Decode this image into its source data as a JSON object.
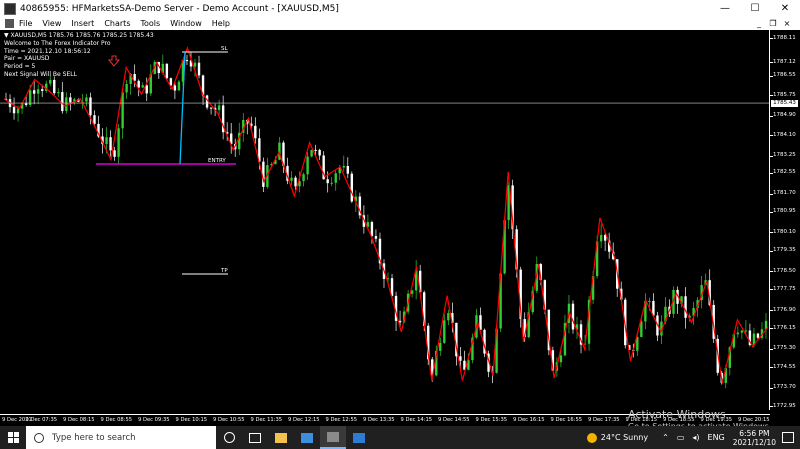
{
  "window": {
    "title": "40865955: HFMarketsSA-Demo Server - Demo Account - [XAUUSD,M5]",
    "minimize": "—",
    "maximize": "☐",
    "close": "✕"
  },
  "menu": {
    "items": [
      "File",
      "View",
      "Insert",
      "Charts",
      "Tools",
      "Window",
      "Help"
    ],
    "mdi": [
      "_",
      "❐",
      "×"
    ]
  },
  "chart": {
    "header": "XAUUSD,M5  1785.76 1785.76 1785.25 1785.43",
    "indicator_lines": [
      "Welcome to The Forex Indicator Pro",
      "Time = 2021.12.10 18:56:12",
      "Pair = XAUUSD",
      "Period = 5",
      "Next Signal Will Be SELL"
    ],
    "sl_label": "SL",
    "entry_label": "ENTRY",
    "tp_label": "TP",
    "current_price": "1785.43",
    "y_ticks": [
      "1788.11",
      "1787.12",
      "1786.55",
      "1785.75",
      "1784.90",
      "1784.10",
      "1783.25",
      "1782.55",
      "1781.70",
      "1780.95",
      "1780.10",
      "1779.35",
      "1778.50",
      "1777.75",
      "1776.90",
      "1776.15",
      "1775.30",
      "1774.55",
      "1773.70",
      "1772.95"
    ],
    "x_ticks": [
      "9 Dec 2021",
      "9 Dec 07:35",
      "9 Dec 08:15",
      "9 Dec 08:55",
      "9 Dec 09:35",
      "9 Dec 10:15",
      "9 Dec 10:55",
      "9 Dec 11:35",
      "9 Dec 12:15",
      "9 Dec 12:55",
      "9 Dec 13:35",
      "9 Dec 14:15",
      "9 Dec 14:55",
      "9 Dec 15:35",
      "9 Dec 16:15",
      "9 Dec 16:55",
      "9 Dec 17:35",
      "9 Dec 18:15",
      "9 Dec 18:55",
      "9 Dec 19:35",
      "9 Dec 20:15"
    ],
    "colors": {
      "bull": "#32cd32",
      "bear": "#ffffff",
      "zigzag": "#ff0000",
      "entry_line": "#ff00ff",
      "sl_tp": "#ffffff",
      "stem": "#00bfff"
    },
    "chart_data": {
      "type": "candlestick",
      "y_range": [
        1772.95,
        1788.11
      ],
      "zigzag_close": [
        1785.6,
        1785.2,
        1786.4,
        1785.9,
        1785.3,
        1785.6,
        1784.4,
        1783.1,
        1786.9,
        1785.8,
        1787.1,
        1786.0,
        1787.7,
        1785.8,
        1785.0,
        1783.5,
        1784.8,
        1782.2,
        1783.4,
        1781.6,
        1783.8,
        1782.4,
        1782.8,
        1781.4,
        1780.0,
        1778.3,
        1776.0,
        1778.7,
        1774.0,
        1777.5,
        1774.0,
        1776.4,
        1774.2,
        1782.6,
        1775.6,
        1778.8,
        1774.1,
        1776.8,
        1775.3,
        1780.7,
        1779.0,
        1774.8,
        1777.3,
        1776.0,
        1777.6,
        1776.4,
        1778.1,
        1773.9,
        1776.5,
        1775.4,
        1776.2
      ]
    }
  },
  "watermark": {
    "line1": "Activate Windows",
    "line2": "Go to Settings to activate Windows."
  },
  "taskbar": {
    "search_placeholder": "Type here to search",
    "weather": "24°C  Sunny",
    "lang": "ENG",
    "time": "6:56 PM",
    "date": "2021/12/10"
  }
}
